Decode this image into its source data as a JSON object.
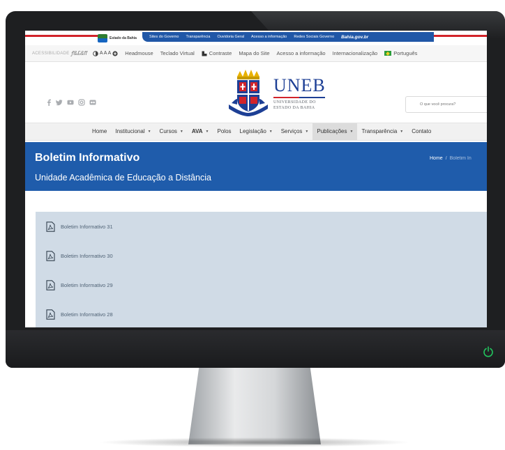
{
  "gov_bar": {
    "logo_text": "Estado da Bahia",
    "links": [
      "Sites do Governo",
      "Transparência",
      "Ouvidoria Geral",
      "Acesso a informação",
      "Redes Sociais Governo"
    ],
    "portal": "Bahia.gov.br"
  },
  "accessibility": {
    "label": "ACESSIBILIDADE",
    "libras": "ꝭ&£&ff",
    "font_size": "A A A",
    "items": [
      "Headmouse",
      "Teclado Virtual",
      "Contraste",
      "Mapa do Site",
      "Acesso a informação",
      "Internacionalização",
      "Português"
    ]
  },
  "header": {
    "social_icons": [
      "facebook-icon",
      "twitter-icon",
      "youtube-icon",
      "instagram-icon",
      "flickr-icon"
    ],
    "brand_name": "UNEB",
    "brand_sub_1": "UNIVERSIDADE DO",
    "brand_sub_2": "ESTADO DA BAHIA",
    "search_placeholder": "O que você procura?"
  },
  "nav": {
    "items": [
      {
        "label": "Home",
        "caret": ""
      },
      {
        "label": "Institucional",
        "caret": "▼"
      },
      {
        "label": "Cursos",
        "caret": "▼"
      },
      {
        "label": "AVA",
        "caret": "▼"
      },
      {
        "label": "Polos",
        "caret": ""
      },
      {
        "label": "Legislação",
        "caret": "▼"
      },
      {
        "label": "Serviços",
        "caret": "▼"
      },
      {
        "label": "Publicações",
        "caret": "▼"
      },
      {
        "label": "Transparência",
        "caret": "▼"
      },
      {
        "label": "Contato",
        "caret": ""
      }
    ]
  },
  "banner": {
    "title": "Boletim Informativo",
    "subtitle": "Unidade Acadêmica de Educação a Distância",
    "breadcrumb_home": "Home",
    "breadcrumb_sep": "/",
    "breadcrumb_current": "Boletim In"
  },
  "documents": [
    {
      "label": "Boletim Informativo 31"
    },
    {
      "label": "Boletim Informativo 30"
    },
    {
      "label": "Boletim Informativo 29"
    },
    {
      "label": "Boletim Informativo 28"
    }
  ],
  "colors": {
    "brand_blue": "#1f5cab",
    "gov_blue": "#2057a7",
    "accent_red": "#d2232a",
    "panel": "#d0dbe6"
  }
}
